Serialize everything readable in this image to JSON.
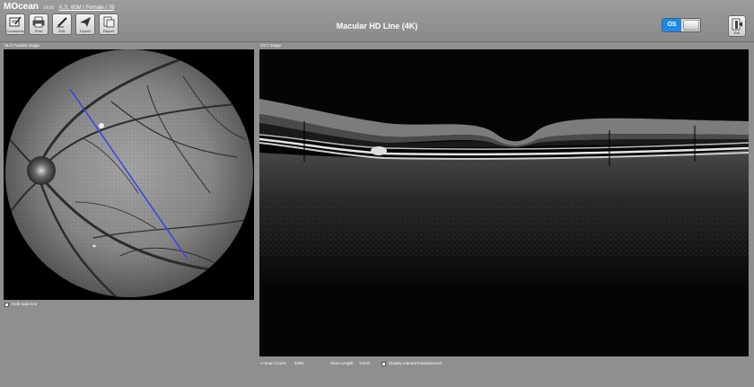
{
  "app": {
    "name": "MOcean",
    "patient_id": "xxxx",
    "patient_info": "K.S. 60M / Female / 78"
  },
  "toolbar": {
    "buttons": [
      {
        "label": "Comments",
        "icon": "comments-icon"
      },
      {
        "label": "Print",
        "icon": "print-icon"
      },
      {
        "label": "Edit",
        "icon": "edit-icon"
      },
      {
        "label": "Export",
        "icon": "export-icon"
      },
      {
        "label": "Report",
        "icon": "report-icon"
      }
    ],
    "exit_label": "Exit"
  },
  "page_title": "Macular HD Line (4K)",
  "eye_selector": {
    "selected": "OS"
  },
  "slo_panel": {
    "label": "SLO Fundus Image",
    "hide_scan_line_label": "Hide scan line",
    "hide_scan_line_checked": false
  },
  "oct_panel": {
    "label": "OCT Image",
    "a_scan_label": "A-Scan Count:",
    "a_scan_value": "4000",
    "scan_length_label": "Scan Length:",
    "scan_length_value": "12mm",
    "manual_measurement_label": "Display manual measurement",
    "manual_measurement_checked": false
  },
  "colors": {
    "scan_line": "#3a48e0",
    "eye_selected": "#1a8ae6",
    "background": "#8f8f8f"
  }
}
